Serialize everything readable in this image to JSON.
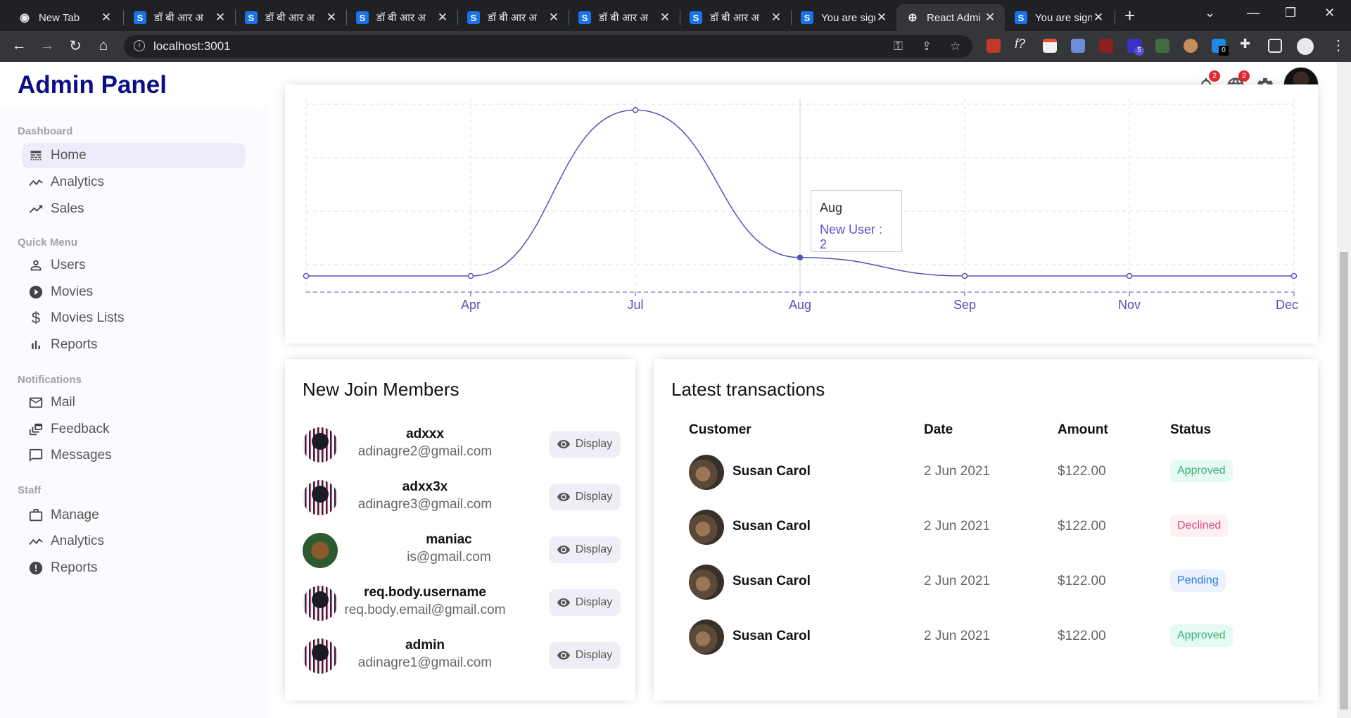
{
  "browser": {
    "tabs": [
      {
        "title": "New Tab",
        "favicon": "chrome-icon"
      },
      {
        "title": "डॉ बी आर अ",
        "favicon": "s-icon"
      },
      {
        "title": "डॉ बी आर अ",
        "favicon": "s-icon"
      },
      {
        "title": "डॉ बी आर अ",
        "favicon": "s-icon"
      },
      {
        "title": "डॉ बी आर अ",
        "favicon": "s-icon"
      },
      {
        "title": "डॉ बी आर अ",
        "favicon": "s-icon"
      },
      {
        "title": "डॉ बी आर अ",
        "favicon": "s-icon"
      },
      {
        "title": "You are sign",
        "favicon": "s-icon"
      },
      {
        "title": "React Admi",
        "favicon": "globe-icon",
        "active": true
      },
      {
        "title": "You are sign",
        "favicon": "s-icon"
      }
    ],
    "url": "localhost:3001",
    "extension_badges": {
      "ext1": "0",
      "ext2": "5"
    }
  },
  "app": {
    "logo": "Admin Panel",
    "notification_badge": "2",
    "language_badge": "2"
  },
  "sidebar": {
    "sections": {
      "dashboard": {
        "title": "Dashboard",
        "items": [
          {
            "label": "Home",
            "icon": "line-style-icon",
            "active": true
          },
          {
            "label": "Analytics",
            "icon": "timeline-icon"
          },
          {
            "label": "Sales",
            "icon": "trending-up-icon"
          }
        ]
      },
      "quick": {
        "title": "Quick Menu",
        "items": [
          {
            "label": "Users",
            "icon": "person-outline-icon"
          },
          {
            "label": "Movies",
            "icon": "play-circle-icon"
          },
          {
            "label": "Movies Lists",
            "icon": "attach-money-icon"
          },
          {
            "label": "Reports",
            "icon": "bar-chart-icon"
          }
        ]
      },
      "notifications": {
        "title": "Notifications",
        "items": [
          {
            "label": "Mail",
            "icon": "mail-outline-icon"
          },
          {
            "label": "Feedback",
            "icon": "dynamic-feed-icon"
          },
          {
            "label": "Messages",
            "icon": "chat-bubble-outline-icon"
          }
        ]
      },
      "staff": {
        "title": "Staff",
        "items": [
          {
            "label": "Manage",
            "icon": "work-outline-icon"
          },
          {
            "label": "Analytics",
            "icon": "timeline-icon"
          },
          {
            "label": "Reports",
            "icon": "report-icon"
          }
        ]
      }
    }
  },
  "chart_data": {
    "type": "line",
    "categories": [
      "",
      "Apr",
      "Jul",
      "Aug",
      "Sep",
      "Nov",
      "Dec"
    ],
    "series": [
      {
        "name": "New User",
        "values": [
          0,
          0,
          9,
          1,
          0,
          0,
          0
        ],
        "color": "#5550bd"
      }
    ],
    "ylim": [
      0,
      10
    ],
    "grid": true,
    "tooltip": {
      "label": "Aug",
      "series": "New User",
      "value": "2"
    }
  },
  "members": {
    "title": "New Join Members",
    "button_label": "Display",
    "list": [
      {
        "username": "adxxx",
        "email": "adinagre2@gmail.com",
        "avatar": "glitch"
      },
      {
        "username": "adxx3x",
        "email": "adinagre3@gmail.com",
        "avatar": "glitch"
      },
      {
        "username": "maniac",
        "email": "is@gmail.com",
        "avatar": "afro"
      },
      {
        "username": "req.body.username",
        "email": "req.body.email@gmail.com",
        "avatar": "glitch"
      },
      {
        "username": "admin",
        "email": "adinagre1@gmail.com",
        "avatar": "glitch"
      }
    ]
  },
  "transactions": {
    "title": "Latest transactions",
    "headers": {
      "customer": "Customer",
      "date": "Date",
      "amount": "Amount",
      "status": "Status"
    },
    "rows": [
      {
        "customer": "Susan Carol",
        "date": "2 Jun 2021",
        "amount": "$122.00",
        "status": "Approved"
      },
      {
        "customer": "Susan Carol",
        "date": "2 Jun 2021",
        "amount": "$122.00",
        "status": "Declined"
      },
      {
        "customer": "Susan Carol",
        "date": "2 Jun 2021",
        "amount": "$122.00",
        "status": "Pending"
      },
      {
        "customer": "Susan Carol",
        "date": "2 Jun 2021",
        "amount": "$122.00",
        "status": "Approved"
      }
    ]
  }
}
